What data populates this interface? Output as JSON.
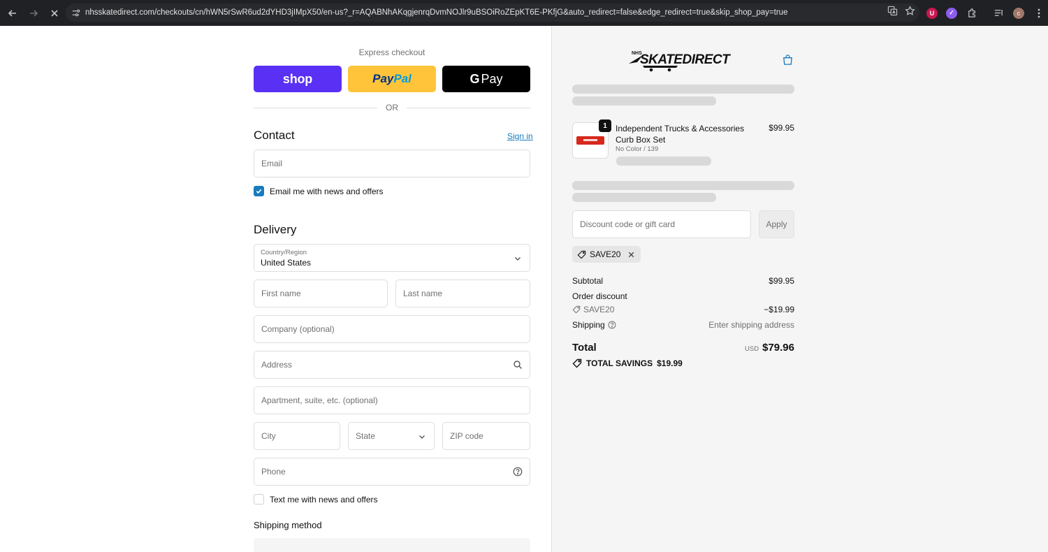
{
  "browser": {
    "url": "nhsskatedirect.com/checkouts/cn/hWN5rSwR6ud2dYHD3jIMpX50/en-us?_r=AQABNhAKqgjenrqDvmNOJlr9uBSOiRoZEpKT6E-PKfjG&auto_redirect=false&edge_redirect=true&skip_shop_pay=true",
    "profile_initial": "c"
  },
  "express": {
    "label": "Express checkout",
    "shop": "shop",
    "paypal_1": "Pay",
    "paypal_2": "Pal",
    "gpay_g": "G",
    "gpay_text": "Pay",
    "or": "OR"
  },
  "contact": {
    "heading": "Contact",
    "sign_in": "Sign in",
    "email_placeholder": "Email",
    "news_label": "Email me with news and offers",
    "news_checked": true
  },
  "delivery": {
    "heading": "Delivery",
    "country_label": "Country/Region",
    "country_value": "United States",
    "first_name": "First name",
    "last_name": "Last name",
    "company": "Company (optional)",
    "address": "Address",
    "apartment": "Apartment, suite, etc. (optional)",
    "city": "City",
    "state": "State",
    "zip": "ZIP code",
    "phone": "Phone",
    "text_offers": "Text me with news and offers",
    "shipping_method": "Shipping method"
  },
  "summary": {
    "logo_text": "SKATEDIRECT",
    "logo_small": "NHS",
    "item": {
      "qty": "1",
      "name": "Independent Trucks & Accessories Curb Box Set",
      "variant": "No Color / 139",
      "price": "$99.95"
    },
    "discount_placeholder": "Discount code or gift card",
    "apply": "Apply",
    "applied_code": "SAVE20",
    "subtotal_label": "Subtotal",
    "subtotal_value": "$99.95",
    "order_discount_label": "Order discount",
    "discount_code": "SAVE20",
    "discount_value": "−$19.99",
    "shipping_label": "Shipping",
    "shipping_value": "Enter shipping address",
    "total_label": "Total",
    "total_currency": "USD",
    "total_value": "$79.96",
    "savings_label": "TOTAL SAVINGS",
    "savings_value": "$19.99"
  },
  "colors": {
    "accent": "#197bbd",
    "shop_purple": "#5a31f4",
    "paypal_yellow": "#ffc439"
  }
}
